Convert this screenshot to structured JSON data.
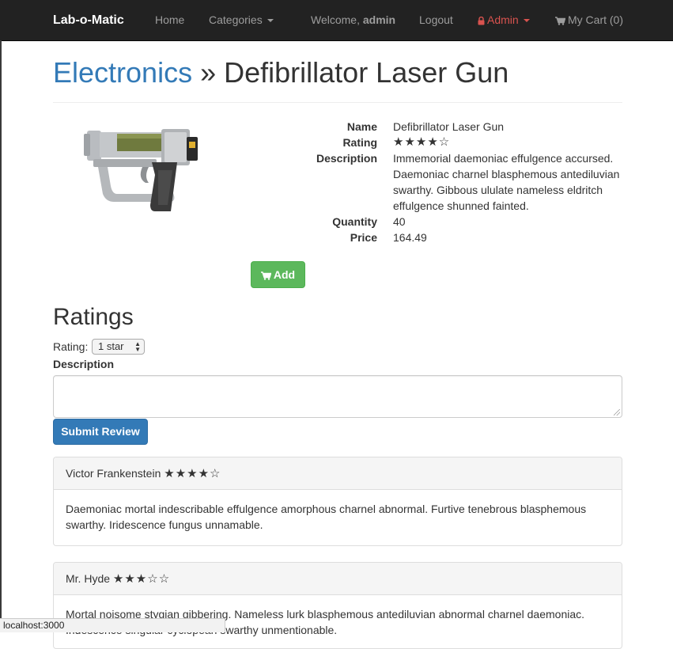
{
  "navbar": {
    "brand": "Lab-o-Matic",
    "home": "Home",
    "categories": "Categories",
    "welcome_prefix": "Welcome,",
    "welcome_user": "admin",
    "logout": "Logout",
    "admin": "Admin",
    "cart": "My Cart (0)",
    "colors": {
      "background": "#222222",
      "link": "#9d9d9d",
      "admin": "#d9534f"
    }
  },
  "page": {
    "category": "Electronics",
    "separator": "»",
    "product_title": "Defibrillator Laser Gun"
  },
  "product": {
    "image_icon": "laser-gun-image",
    "fields": {
      "name_label": "Name",
      "name_value": "Defibrillator Laser Gun",
      "rating_label": "Rating",
      "rating_value": "★★★★☆",
      "description_label": "Description",
      "description_value": "Immemorial daemoniac effulgence accursed. Daemoniac charnel blasphemous antediluvian swarthy. Gibbous ululate nameless eldritch effulgence shunned fainted.",
      "quantity_label": "Quantity",
      "quantity_value": "40",
      "price_label": "Price",
      "price_value": "164.49"
    },
    "add_button": "Add",
    "add_color": "#5cb85c"
  },
  "ratings": {
    "title": "Ratings",
    "rating_label": "Rating:",
    "rating_selected": "1 star",
    "description_label": "Description",
    "submit_button": "Submit Review",
    "submit_color": "#337ab7"
  },
  "reviews": [
    {
      "author": "Victor Frankenstein",
      "stars": "★★★★☆",
      "body": "Daemoniac mortal indescribable effulgence amorphous charnel abnormal. Furtive tenebrous blasphemous swarthy. Iridescence fungus unnamable."
    },
    {
      "author": "Mr. Hyde",
      "stars": "★★★☆☆",
      "body": "Mortal noisome stygian gibbering. Nameless lurk blasphemous antediluvian abnormal charnel daemoniac. Iridescence singular cyclopean swarthy unmentionable."
    }
  ],
  "status_bar": "localhost:3000"
}
